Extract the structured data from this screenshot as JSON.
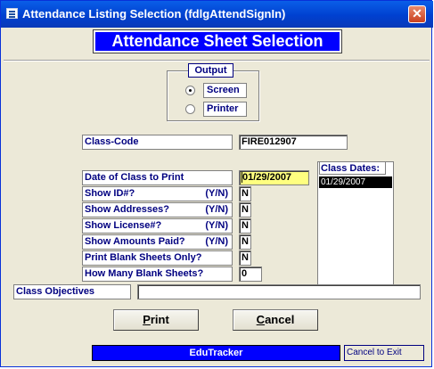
{
  "window": {
    "title": "Attendance Listing Selection (fdlgAttendSignIn)",
    "close_glyph": "✕"
  },
  "header": {
    "banner": "Attendance Sheet Selection"
  },
  "output": {
    "title": "Output",
    "options": [
      {
        "label": "Screen",
        "selected": true
      },
      {
        "label": "Printer",
        "selected": false
      }
    ]
  },
  "class_code": {
    "label": "Class-Code",
    "value": "FIRE012907"
  },
  "fields": {
    "date_of_class": {
      "label": "Date of Class to Print",
      "value": "01/29/2007"
    },
    "show_id": {
      "label": "Show ID#?",
      "hint": "(Y/N)",
      "value": "N"
    },
    "show_addresses": {
      "label": "Show Addresses?",
      "hint": "(Y/N)",
      "value": "N"
    },
    "show_license": {
      "label": "Show License#?",
      "hint": "(Y/N)",
      "value": "N"
    },
    "show_amounts": {
      "label": "Show Amounts Paid?",
      "hint": "(Y/N)",
      "value": "N"
    },
    "print_blank_only": {
      "label": "Print Blank Sheets Only?",
      "value": "N"
    },
    "how_many_blank": {
      "label": "How Many Blank Sheets?",
      "value": "0"
    }
  },
  "class_dates": {
    "title": "Class Dates:",
    "items": [
      "01/29/2007"
    ]
  },
  "class_objectives": {
    "label": "Class Objectives",
    "value": ""
  },
  "buttons": {
    "print": {
      "accel": "P",
      "rest": "rint"
    },
    "cancel": {
      "accel": "C",
      "rest": "ancel"
    }
  },
  "status": {
    "app_name": "EduTracker",
    "cancel_hint": "Cancel to Exit"
  },
  "colors": {
    "accent": "#0000ff",
    "label_text": "#000080",
    "date_highlight": "#ffff80"
  }
}
